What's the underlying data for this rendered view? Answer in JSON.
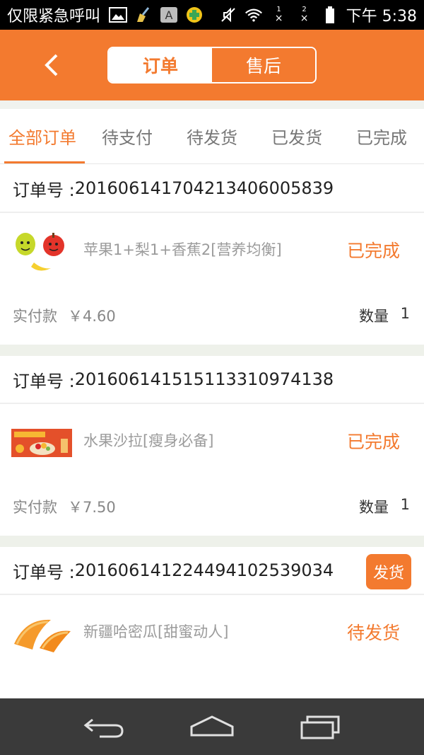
{
  "statusbar": {
    "carrier": "仅限紧急呼叫",
    "time": "下午 5:38",
    "icons_left": [
      "image-icon",
      "broom-icon",
      "a-icon",
      "cross-app-icon"
    ],
    "icons_right": [
      "mute-icon",
      "wifi-icon",
      "signal-1-icon",
      "signal-2-icon",
      "battery-icon"
    ],
    "sim1": "1",
    "sim2": "2"
  },
  "header": {
    "segments": [
      {
        "label": "订单",
        "active": true
      },
      {
        "label": "售后",
        "active": false
      }
    ],
    "accent": "#f37a2f"
  },
  "tabs": [
    {
      "label": "全部订单",
      "active": true
    },
    {
      "label": "待支付",
      "active": false
    },
    {
      "label": "待发货",
      "active": false
    },
    {
      "label": "已发货",
      "active": false
    },
    {
      "label": "已完成",
      "active": false
    }
  ],
  "orders": [
    {
      "order_label": "订单号 : ",
      "order_no": "20160614170421340600583 9",
      "product": "苹果1+梨1+香蕉2[营养均衡]",
      "status": "已完成",
      "paid_label": "实付款",
      "paid_value": "￥4.60",
      "qty_label": "数量",
      "qty": "1",
      "thumb": "fruit-mix-icon"
    },
    {
      "order_label": "订单号 : ",
      "order_no": "20160614151511331097413 8",
      "product": "水果沙拉[瘦身必备]",
      "status": "已完成",
      "paid_label": "实付款",
      "paid_value": "￥7.50",
      "qty_label": "数量",
      "qty": "1",
      "thumb": "salad-banner-icon"
    },
    {
      "order_label": "订单号 : ",
      "order_no": "20160614122449410253903 4",
      "product": "新疆哈密瓜[甜蜜动人]",
      "status": "待发货",
      "ship_button": "发货",
      "thumb": "melon-icon"
    }
  ],
  "navbar": {
    "icons": [
      "back-icon",
      "home-icon",
      "recents-icon"
    ]
  }
}
